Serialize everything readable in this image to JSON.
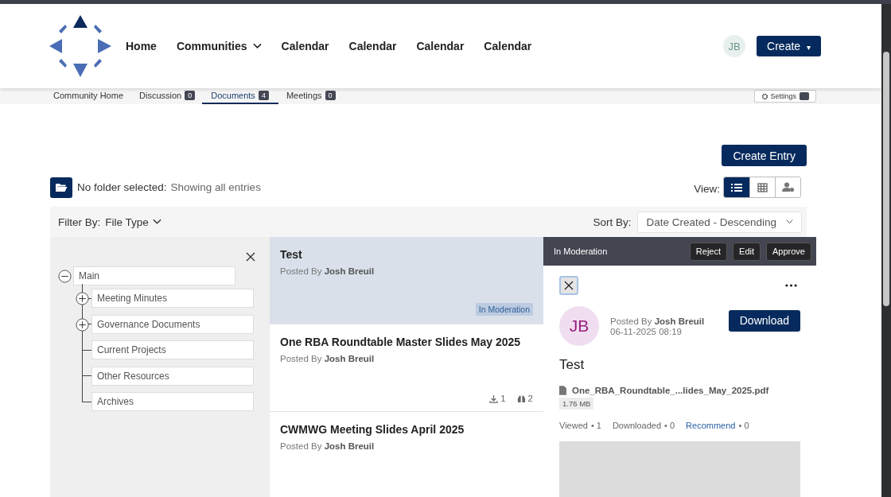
{
  "nav": {
    "items": [
      {
        "label": "Home",
        "kind": "link"
      },
      {
        "label": "Communities",
        "kind": "dropdown"
      },
      {
        "label": "Calendar",
        "kind": "link"
      },
      {
        "label": "Calendar",
        "kind": "link"
      },
      {
        "label": "Calendar",
        "kind": "link"
      },
      {
        "label": "Calendar",
        "kind": "link"
      }
    ],
    "avatar": "JB",
    "create": "Create",
    "create_caret": "▾"
  },
  "tabs": [
    {
      "label": "Community Home",
      "selected": false
    },
    {
      "label": "Discussion",
      "count": "0",
      "selected": false
    },
    {
      "label": "Documents",
      "count": "4",
      "selected": true
    },
    {
      "label": "Meetings",
      "count": "0",
      "selected": false
    }
  ],
  "settings": "Settings",
  "create_entry": "Create Entry",
  "folder": {
    "label": "No folder selected:",
    "value": "Showing all entries"
  },
  "view": {
    "label": "View:",
    "options": [
      {
        "kind": "list",
        "selected": true
      },
      {
        "kind": "grid",
        "selected": false
      },
      {
        "kind": "user-settings",
        "selected": false
      }
    ]
  },
  "filter": {
    "label": "Filter By:",
    "value": "File Type"
  },
  "sort": {
    "label": "Sort By:",
    "value": "Date Created - Descending"
  },
  "tree": [
    {
      "label": "Main",
      "kind": "expanded",
      "children": [
        {
          "label": "Meeting Minutes",
          "kind": "collapsed"
        },
        {
          "label": "Governance Documents",
          "kind": "collapsed"
        },
        {
          "label": "Current Projects",
          "kind": "leaf"
        },
        {
          "label": "Other Resources",
          "kind": "leaf"
        },
        {
          "label": "Archives",
          "kind": "leaf"
        }
      ]
    }
  ],
  "entries": [
    {
      "title": "Test",
      "posted_by": "Posted By",
      "author": "Josh Breuil",
      "selected": true,
      "badge": "In Moderation"
    },
    {
      "title": "One RBA Roundtable Master Slides May 2025",
      "posted_by": "Posted By",
      "author": "Josh Breuil",
      "selected": false,
      "downloads": "1",
      "views": "2"
    },
    {
      "title": "CWMWG Meeting Slides April 2025",
      "posted_by": "Posted By",
      "author": "Josh Breuil",
      "selected": false
    }
  ],
  "detail": {
    "status": "In Moderation",
    "actions": [
      "Reject",
      "Edit",
      "Approve"
    ],
    "avatar": "JB",
    "posted_by": "Posted By",
    "author": "Josh Breuil",
    "date": "06-11-2025 08:19",
    "download": "Download",
    "title": "Test",
    "file": "One_RBA_Roundtable_...lides_May_2025.pdf",
    "size": "1.76 MB",
    "separator": "•",
    "stats": [
      {
        "label": "Viewed",
        "value": "1",
        "kind": "text"
      },
      {
        "label": "Downloaded",
        "value": "0",
        "kind": "text"
      },
      {
        "label": "Recommend",
        "value": "0",
        "kind": "link"
      }
    ]
  }
}
